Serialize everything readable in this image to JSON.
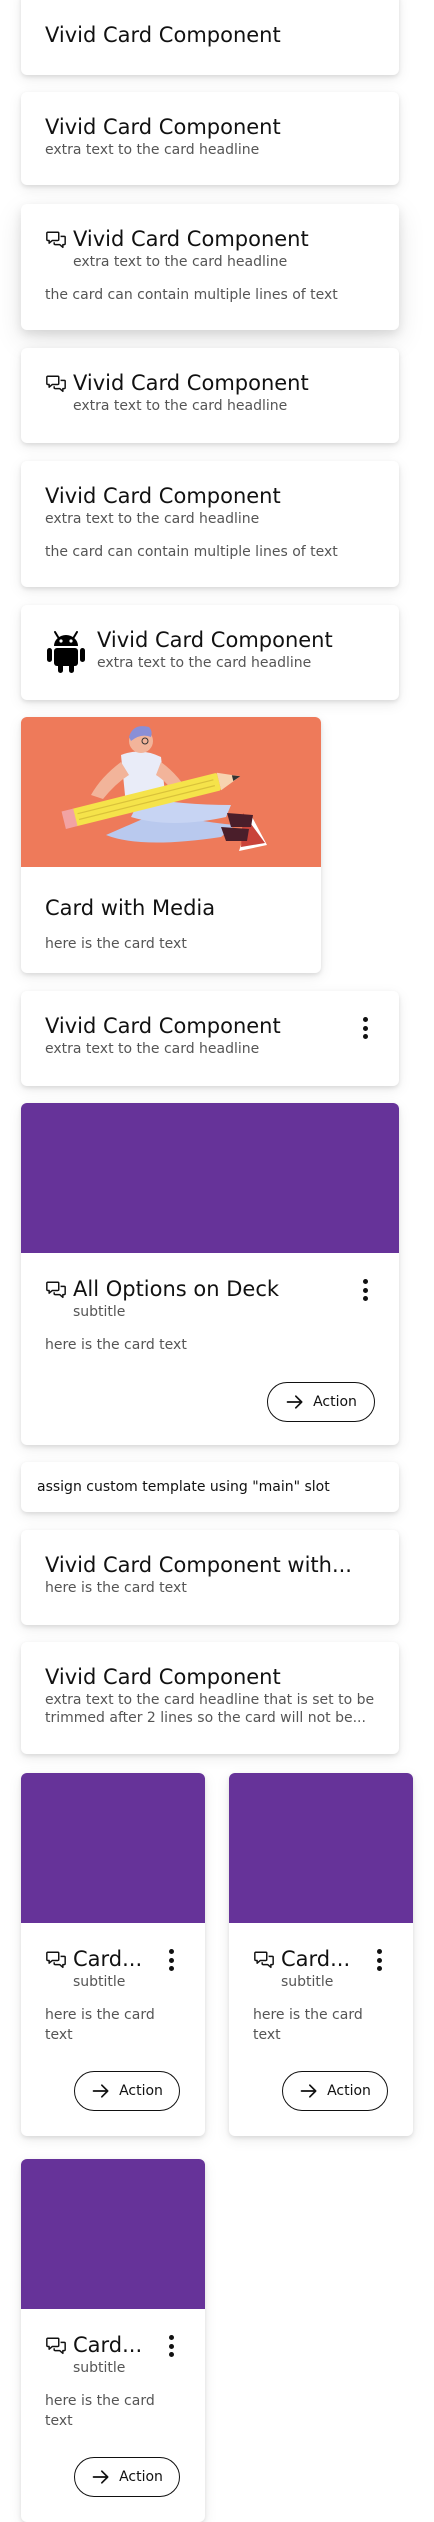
{
  "colors": {
    "media_purple": "#663399",
    "media_coral": "#ee7a5a",
    "text_secondary": "#555555"
  },
  "icons": {
    "chat": "chat-bubbles-icon",
    "android": "android-icon",
    "more": "more-vertical-icon",
    "arrow": "arrow-right-icon"
  },
  "cards": {
    "c1": {
      "title": "Vivid Card Component"
    },
    "c2": {
      "title": "Vivid Card Component",
      "subtitle": "extra text to the card headline"
    },
    "c3": {
      "title": "Vivid Card Component",
      "subtitle": "extra text to the card headline",
      "text": "the card can contain multiple lines of text"
    },
    "c4": {
      "title": "Vivid Card Component",
      "subtitle": "extra text to the card headline"
    },
    "c5": {
      "title": "Vivid Card Component",
      "subtitle": "extra text to the card headline",
      "text": "the card can contain multiple lines of text"
    },
    "c6": {
      "title": "Vivid Card Component",
      "subtitle": "extra text to the card headline"
    },
    "c7": {
      "title": "Card with Media",
      "text": "here is the card text"
    },
    "c8": {
      "title": "Vivid Card Component",
      "subtitle": "extra text to the card headline"
    },
    "c9": {
      "title": "All Options on Deck",
      "subtitle": "subtitle",
      "text": "here is the card text",
      "action": "Action"
    },
    "c10": {
      "text": "assign custom template using \"main\" slot"
    },
    "c11": {
      "title": "Vivid Card Component with...",
      "text": "here is the card text"
    },
    "c12": {
      "title": "Vivid Card Component",
      "subtitle": "extra text to the card headline that is set to be trimmed after 2 lines so the card will not be..."
    },
    "grid": [
      {
        "title": "Card...",
        "subtitle": "subtitle",
        "text": "here is the card text",
        "action": "Action"
      },
      {
        "title": "Card...",
        "subtitle": "subtitle",
        "text": "here is the card text",
        "action": "Action"
      },
      {
        "title": "Card...",
        "subtitle": "subtitle",
        "text": "here is the card text",
        "action": "Action"
      }
    ]
  }
}
